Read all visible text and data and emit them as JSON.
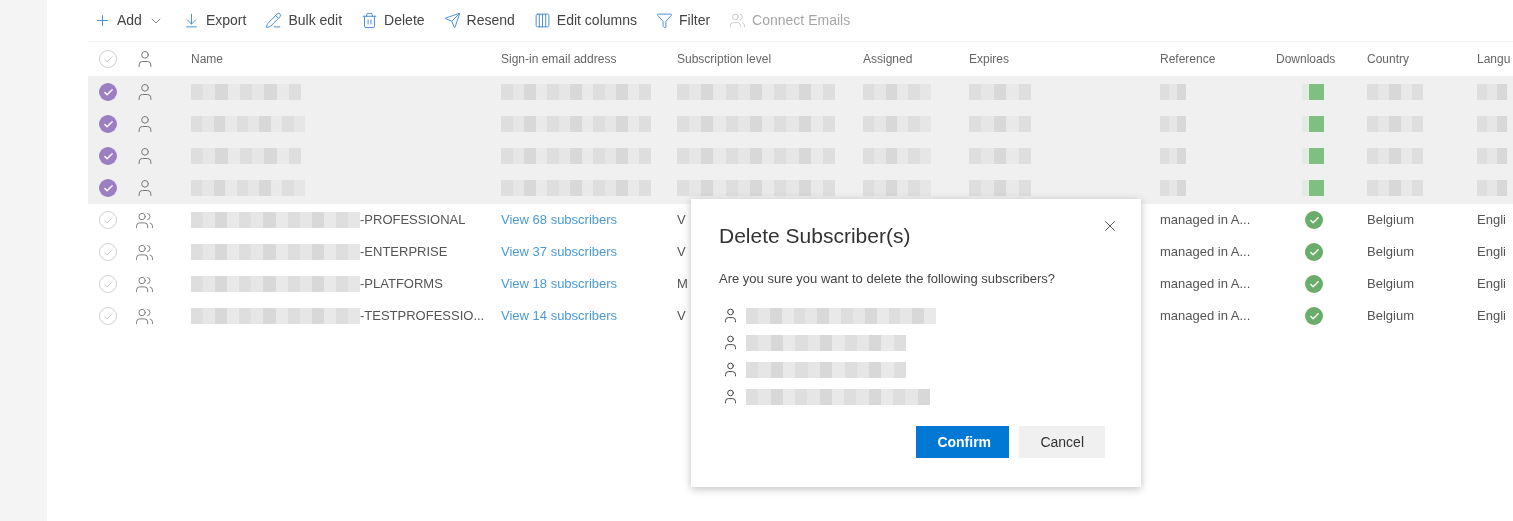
{
  "toolbar": [
    {
      "label": "Add",
      "menu": true,
      "disabled": false
    },
    {
      "label": "Export",
      "menu": false,
      "disabled": false
    },
    {
      "label": "Bulk edit",
      "menu": false,
      "disabled": false
    },
    {
      "label": "Delete",
      "menu": false,
      "disabled": false
    },
    {
      "label": "Resend",
      "menu": false,
      "disabled": false
    },
    {
      "label": "Edit columns",
      "menu": false,
      "disabled": false
    },
    {
      "label": "Filter",
      "menu": false,
      "disabled": false
    },
    {
      "label": "Connect Emails",
      "menu": false,
      "disabled": true
    }
  ],
  "table": {
    "select_all": {
      "checked": false
    },
    "columns": [
      "Name",
      "Sign-in email address",
      "Subscription level",
      "Assigned",
      "Expires",
      "Reference",
      "Downloads",
      "Country",
      "Langu"
    ],
    "rows": [
      {
        "kind": "user",
        "selected": true
      },
      {
        "kind": "user",
        "selected": true
      },
      {
        "kind": "user",
        "selected": true
      },
      {
        "kind": "user",
        "selected": true
      },
      {
        "kind": "group",
        "selected": false,
        "name": "-PROFESSIONAL",
        "email": "View 68 subscribers",
        "subscription_level": "V",
        "reference": "managed in A...",
        "downloaded": true,
        "country": "Belgium",
        "language": "Engli"
      },
      {
        "kind": "group",
        "selected": false,
        "name": "-ENTERPRISE",
        "email": "View 37 subscribers",
        "subscription_level": "V",
        "reference": "managed in A...",
        "downloaded": true,
        "country": "Belgium",
        "language": "Engli"
      },
      {
        "kind": "group",
        "selected": false,
        "name": "-PLATFORMS",
        "email": "View 18 subscribers",
        "subscription_level": "M",
        "reference": "managed in A...",
        "downloaded": true,
        "country": "Belgium",
        "language": "Engli"
      },
      {
        "kind": "group",
        "selected": false,
        "name": "-TESTPROFESSIO...",
        "email": "View 14 subscribers",
        "subscription_level": "V",
        "reference": "managed in A...",
        "downloaded": true,
        "country": "Belgium",
        "language": "Engli"
      }
    ]
  },
  "dialog": {
    "title": "Delete Subscriber(s)",
    "message": "Are you sure you want to delete the following subscribers?",
    "buttons": [
      {
        "label": "Confirm",
        "kind": "primary"
      },
      {
        "label": "Cancel",
        "kind": "secondary"
      }
    ]
  }
}
